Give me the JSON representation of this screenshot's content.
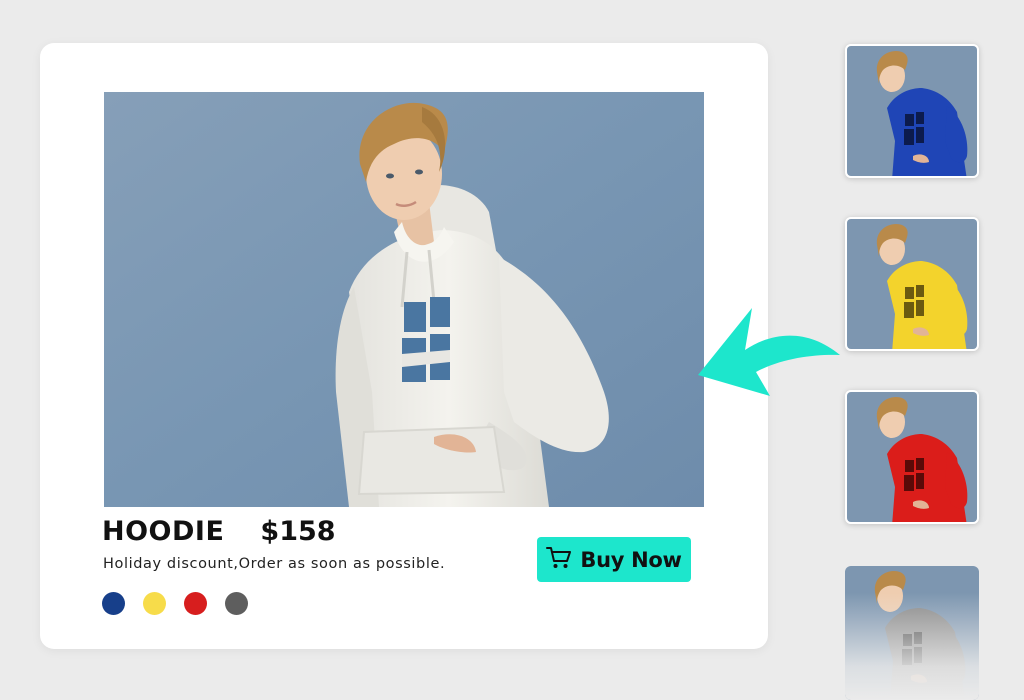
{
  "product": {
    "name": "HOODIE",
    "price": "$158",
    "tagline": "Holiday discount,Order as soon as possible."
  },
  "buy_button": {
    "label": "Buy Now",
    "icon": "cart-icon",
    "color": "#1de6cc"
  },
  "main_image": {
    "hoodie_color": "#f2f1ec",
    "background_color": "#7e9bb7",
    "graphic_color": "#4a76a1"
  },
  "swatches": [
    {
      "name": "blue",
      "color": "#173f8a"
    },
    {
      "name": "yellow",
      "color": "#f7dc4a"
    },
    {
      "name": "red",
      "color": "#d71e1e"
    },
    {
      "name": "gray",
      "color": "#5e5e5e"
    }
  ],
  "thumbnails": [
    {
      "name": "blue",
      "hoodie_color": "#1f45b6",
      "graphic_color": "#0c1b4d"
    },
    {
      "name": "yellow",
      "hoodie_color": "#f3d32c",
      "graphic_color": "#6b5a10"
    },
    {
      "name": "red",
      "hoodie_color": "#db1d1a",
      "graphic_color": "#5a0a08"
    },
    {
      "name": "gray",
      "hoodie_color": "#8a8a8a",
      "graphic_color": "#444444"
    }
  ],
  "accent_arrow_color": "#1de6cc"
}
